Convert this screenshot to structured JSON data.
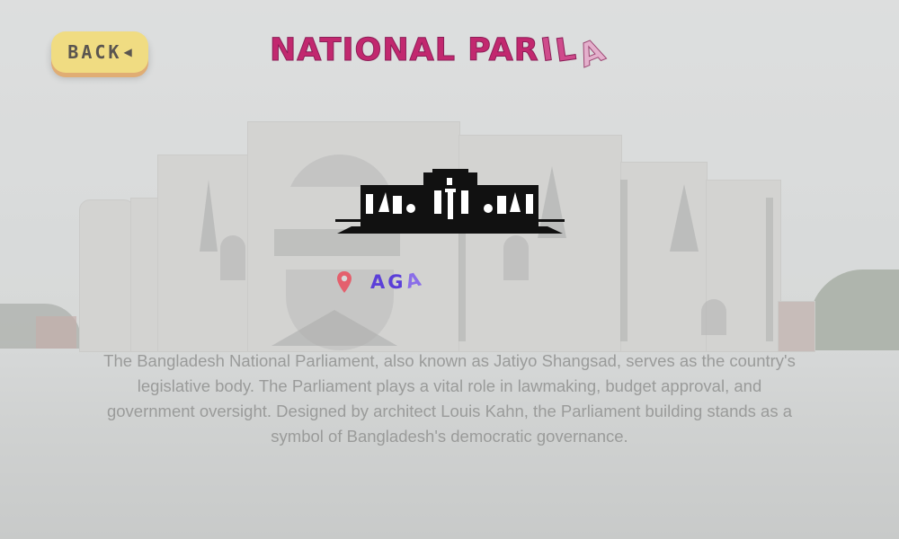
{
  "back_button": {
    "label": "BACK",
    "arrow_icon": "caret-left-icon"
  },
  "title": {
    "main": "NATIONAL PAR",
    "glitch_1": "I",
    "glitch_2": "L",
    "glitch_3": "A"
  },
  "logo": {
    "icon": "parliament-building-icon"
  },
  "location": {
    "icon": "map-pin-icon",
    "text_main": "AG",
    "text_tilt": "A",
    "pin_color": "#e4606d"
  },
  "description": "The Bangladesh National Parliament, also known as Jatiyo Shangsad, serves as the country's legislative body. The Parliament plays a vital role in lawmaking, budget approval, and government oversight. Designed by architect Louis Kahn, the Parliament building stands as a symbol of Bangladesh's democratic governance.",
  "colors": {
    "back_button_bg": "#f0dc82",
    "title": "#c2286f",
    "location_text": "#5b3fd8"
  }
}
